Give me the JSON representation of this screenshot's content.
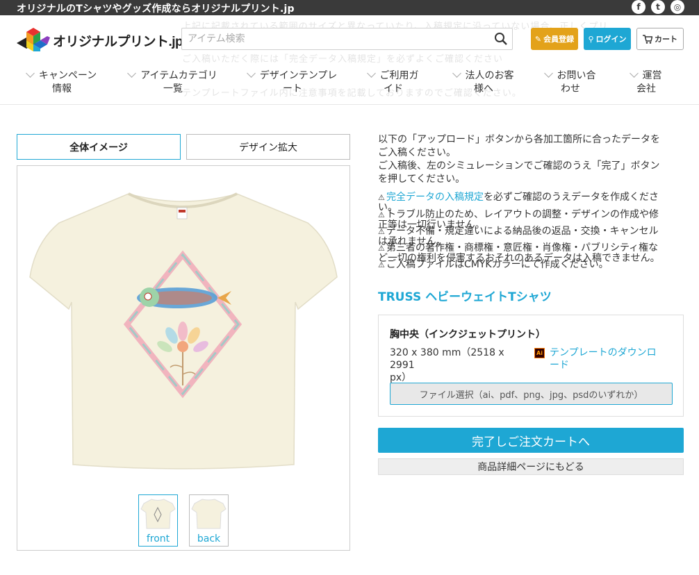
{
  "topbar": {
    "tagline": "オリジナルのTシャツやグッズ作成ならオリジナルプリント.jp",
    "social": [
      {
        "icon": "facebook-icon",
        "glyph": "f"
      },
      {
        "icon": "twitter-icon",
        "glyph": "t"
      },
      {
        "icon": "instagram-icon",
        "glyph": "◎"
      }
    ]
  },
  "header": {
    "logo_text": "オリジナルプリント.jp",
    "search_placeholder": "アイテム検索",
    "register_label": "会員登録",
    "login_label": "ログイン",
    "cart_label": "カート"
  },
  "background_text": [
    "上記に記載されている範囲のサイズと異なっていたり、入稿規定に沿っていない場合、正しくプリ",
    "ご入稿いただく際には「完全データ入稿規定」を必ずよくご確認ください",
    "テンプレートファイル内に注意事項を記載しておりますのでご確認ください。"
  ],
  "nav": [
    {
      "line1": "キャンペーン",
      "line2": "情報"
    },
    {
      "line1": "アイテムカテゴリ",
      "line2": "一覧"
    },
    {
      "line1": "デザインテンプレ",
      "line2": "ート"
    },
    {
      "line1": "ご利用ガ",
      "line2": "イド"
    },
    {
      "line1": "法人のお客",
      "line2": "様へ"
    },
    {
      "line1": "お問い合",
      "line2": "わせ"
    },
    {
      "line1": "運営",
      "line2": "会社"
    }
  ],
  "tabs": {
    "overview": "全体イメージ",
    "zoom": "デザイン拡大"
  },
  "thumbnails": {
    "front": "front",
    "back": "back"
  },
  "instructions": {
    "line1": "以下の「アップロード」ボタンから各加工箇所に合ったデータを",
    "line2": "ご入稿ください。",
    "line3": "ご入稿後、左のシミュレーションでご確認のうえ「完了」ボタン",
    "line4": "を押してください。"
  },
  "notes": {
    "n1_link": "完全データの入稿規定",
    "n1_rest": "を必ずご確認のうえデータを作成くださ",
    "n1_cont": "い。",
    "n2": "トラブル防止のため、レイアウトの調整・デザインの作成や修",
    "n2_cont": "正等は一切行いません。",
    "n3": "データ不備・規定違いによる納品後の返品・交換・キャンセル",
    "n3_cont": "は承れません。",
    "n4": "第三者の著作権・商標権・意匠権・肖像権・パブリシティ権な",
    "n4_cont": "ど一切の権利を侵害するおそれのあるデータは入稿できません。",
    "n5": "ご入稿ファイルはCMYKカラーにて作成ください。"
  },
  "product": {
    "title": "TRUSS ヘビーウェイトTシャツ",
    "location": "胸中央（インクジェットプリント）",
    "size_line1": "320 x 380 mm（2518 x 2991",
    "size_line2": "px）",
    "template_line1": "テンプレートのダウンロ",
    "template_line2": "ード",
    "ai_badge": "Ai",
    "file_button": "ファイル選択（ai、pdf、png、jpg、psdのいずれか）"
  },
  "actions": {
    "complete": "完了しご注文カートへ",
    "back": "商品詳細ページにもどる"
  },
  "colors": {
    "accent": "#1ea7d4",
    "register": "#e3a21a",
    "topbar": "#3a3a3a",
    "shirt": "#f5f1de"
  }
}
